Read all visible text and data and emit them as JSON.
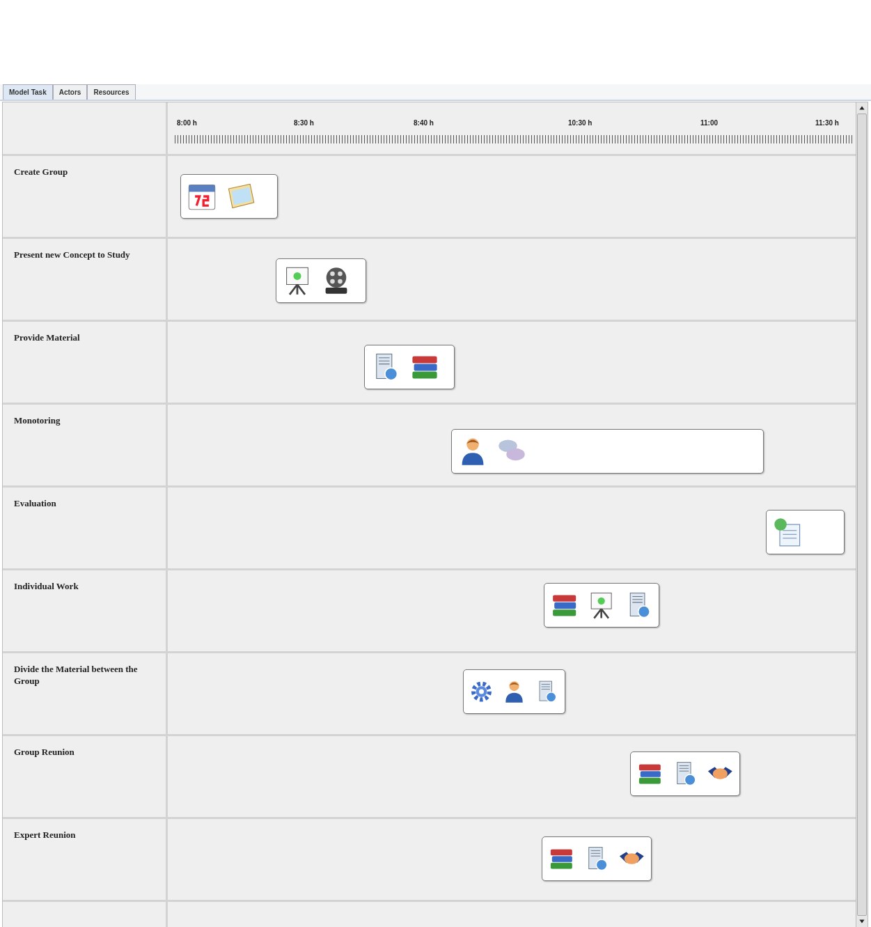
{
  "tabs": [
    {
      "label": "Model Task",
      "selected": true
    },
    {
      "label": "Actors",
      "selected": false
    },
    {
      "label": "Resources",
      "selected": false
    }
  ],
  "timeline": {
    "ticks": [
      "8:00 h",
      "8:30 h",
      "8:40 h",
      "10:30 h",
      "11:00",
      "11:30 h"
    ]
  },
  "tasks": [
    {
      "name": "Create Group"
    },
    {
      "name": "Present new Concept to Study"
    },
    {
      "name": "Provide Material"
    },
    {
      "name": "Monotoring"
    },
    {
      "name": "Evaluation"
    },
    {
      "name": "Individual Work"
    },
    {
      "name": "Divide the Material between the Group"
    },
    {
      "name": "Group Reunion"
    },
    {
      "name": "Expert Reunion"
    }
  ]
}
